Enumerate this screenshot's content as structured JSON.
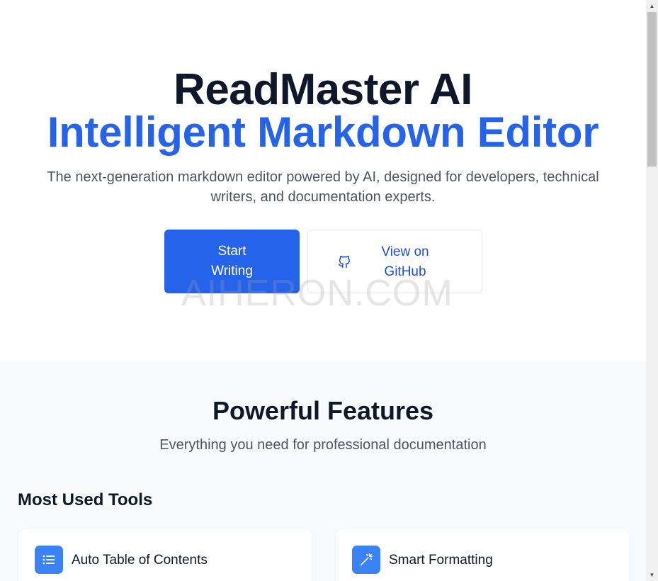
{
  "hero": {
    "title": "ReadMaster AI",
    "subtitle": "Intelligent Markdown Editor",
    "description": "The next-generation markdown editor powered by AI, designed for developers, technical writers, and documentation experts.",
    "primary_button": "Start Writing",
    "secondary_button": "View on GitHub",
    "secondary_icon": "github-icon",
    "accent_color": "#2563eb"
  },
  "watermark": "AIHERON.COM",
  "features": {
    "title": "Powerful Features",
    "description": "Everything you need for professional documentation",
    "tools_heading": "Most Used Tools",
    "cards": [
      {
        "label": "Auto Table of Contents",
        "icon": "list-icon"
      },
      {
        "label": "Smart Formatting",
        "icon": "magic-wand-icon"
      }
    ]
  }
}
